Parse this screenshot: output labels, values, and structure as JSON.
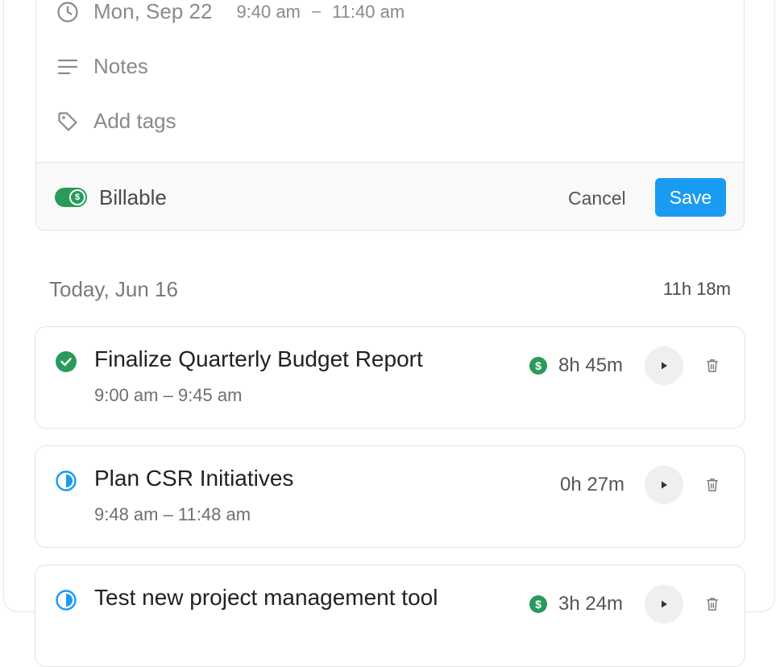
{
  "edit_form": {
    "date": "Mon, Sep 22",
    "start_time": "9:40 am",
    "time_separator": "–",
    "end_time": "11:40 am",
    "notes_placeholder": "Notes",
    "tags_placeholder": "Add tags",
    "billable_label": "Billable",
    "billable_on": true,
    "cancel_label": "Cancel",
    "save_label": "Save"
  },
  "day": {
    "title": "Today, Jun 16",
    "total": "11h 18m"
  },
  "entries": [
    {
      "title": "Finalize Quarterly Budget Report",
      "time_range": "9:00 am – 9:45 am",
      "duration": "8h 45m",
      "billable": true,
      "status": "completed"
    },
    {
      "title": "Plan CSR Initiatives",
      "time_range": "9:48 am – 11:48 am",
      "duration": "0h 27m",
      "billable": false,
      "status": "in-progress"
    },
    {
      "title": "Test new project management tool",
      "time_range": "",
      "duration": "3h 24m",
      "billable": true,
      "status": "in-progress"
    }
  ],
  "billable_symbol": "$",
  "colors": {
    "accent": "#1a9bf2",
    "billable_green": "#2a9a5a",
    "muted_text": "#8a8a8a"
  },
  "icons": {
    "date_row": "clock-icon",
    "notes_row": "notes-lines-icon",
    "tags_row": "tag-icon",
    "completed": "check-circle-icon",
    "in_progress": "half-circle-icon",
    "play": "play-icon",
    "delete": "trash-icon"
  }
}
